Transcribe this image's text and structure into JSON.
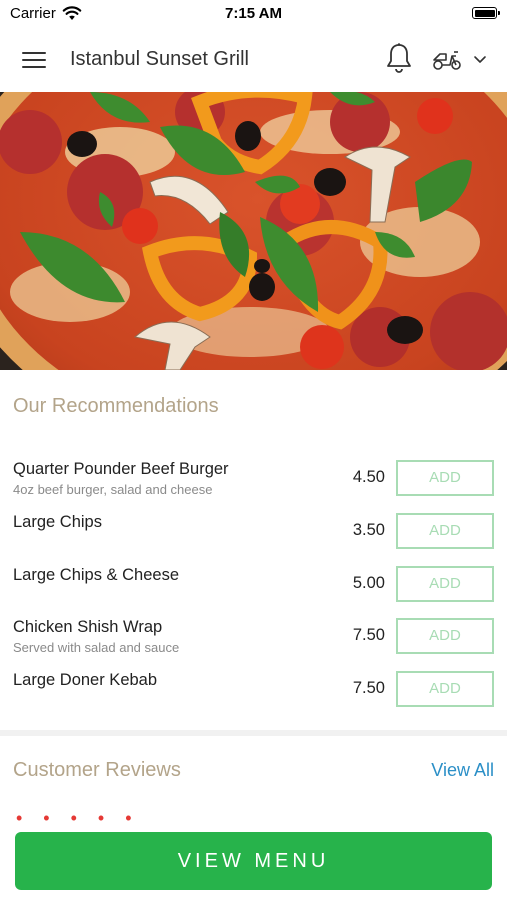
{
  "status_bar": {
    "carrier": "Carrier",
    "time": "7:15 AM"
  },
  "header": {
    "title": "Istanbul Sunset Grill"
  },
  "recommendations": {
    "title": "Our Recommendations",
    "items": [
      {
        "name": "Quarter Pounder Beef Burger",
        "description": "4oz beef burger, salad and cheese",
        "price": "4.50",
        "button_label": "ADD"
      },
      {
        "name": "Large Chips",
        "description": "",
        "price": "3.50",
        "button_label": "ADD"
      },
      {
        "name": "Large Chips & Cheese",
        "description": "",
        "price": "5.00",
        "button_label": "ADD"
      },
      {
        "name": "Chicken Shish Wrap",
        "description": "Served with salad and sauce",
        "price": "7.50",
        "button_label": "ADD"
      },
      {
        "name": "Large Doner Kebab",
        "description": "",
        "price": "7.50",
        "button_label": "ADD"
      }
    ]
  },
  "reviews": {
    "title": "Customer Reviews",
    "view_all_label": "View All",
    "stars": "• • • • •"
  },
  "footer": {
    "view_menu_label": "VIEW MENU"
  },
  "colors": {
    "accent_green": "#27b34b",
    "add_border": "#a8dcb4",
    "section_title": "#b3a48a",
    "link_blue": "#2b8fc7",
    "star_red": "#e53935"
  },
  "icons": [
    "wifi-icon",
    "battery-icon",
    "menu-icon",
    "bell-icon",
    "scooter-icon",
    "chevron-down-icon"
  ]
}
